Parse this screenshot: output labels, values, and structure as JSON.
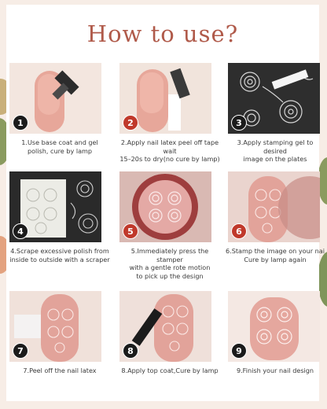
{
  "title": "How to use?",
  "steps": [
    {
      "num": "1",
      "caption_l1": "1.Use base coat and gel",
      "caption_l2": "polish, cure by lamp",
      "caption_l3": ""
    },
    {
      "num": "2",
      "caption_l1": "2.Apply nail latex peel off tape wait",
      "caption_l2": "15–20s to dry(no cure by lamp)",
      "caption_l3": ""
    },
    {
      "num": "3",
      "caption_l1": "3.Apply stamping gel to desired",
      "caption_l2": "image on the plates",
      "caption_l3": ""
    },
    {
      "num": "4",
      "caption_l1": "4.Scrape excessive polish from",
      "caption_l2": "inside to outside with a scraper",
      "caption_l3": ""
    },
    {
      "num": "5",
      "caption_l1": "5.Immediately press the stamper",
      "caption_l2": "with a gentle rote motion",
      "caption_l3": "to pick up the design"
    },
    {
      "num": "6",
      "caption_l1": "6.Stamp the image on your nai",
      "caption_l2": "Cure by lamp again",
      "caption_l3": ""
    },
    {
      "num": "7",
      "caption_l1": "7.Peel off the nail latex",
      "caption_l2": "",
      "caption_l3": ""
    },
    {
      "num": "8",
      "caption_l1": "8.Apply top coat,Cure by lamp",
      "caption_l2": "",
      "caption_l3": ""
    },
    {
      "num": "9",
      "caption_l1": "9.Finish your nail design",
      "caption_l2": "",
      "caption_l3": ""
    }
  ]
}
